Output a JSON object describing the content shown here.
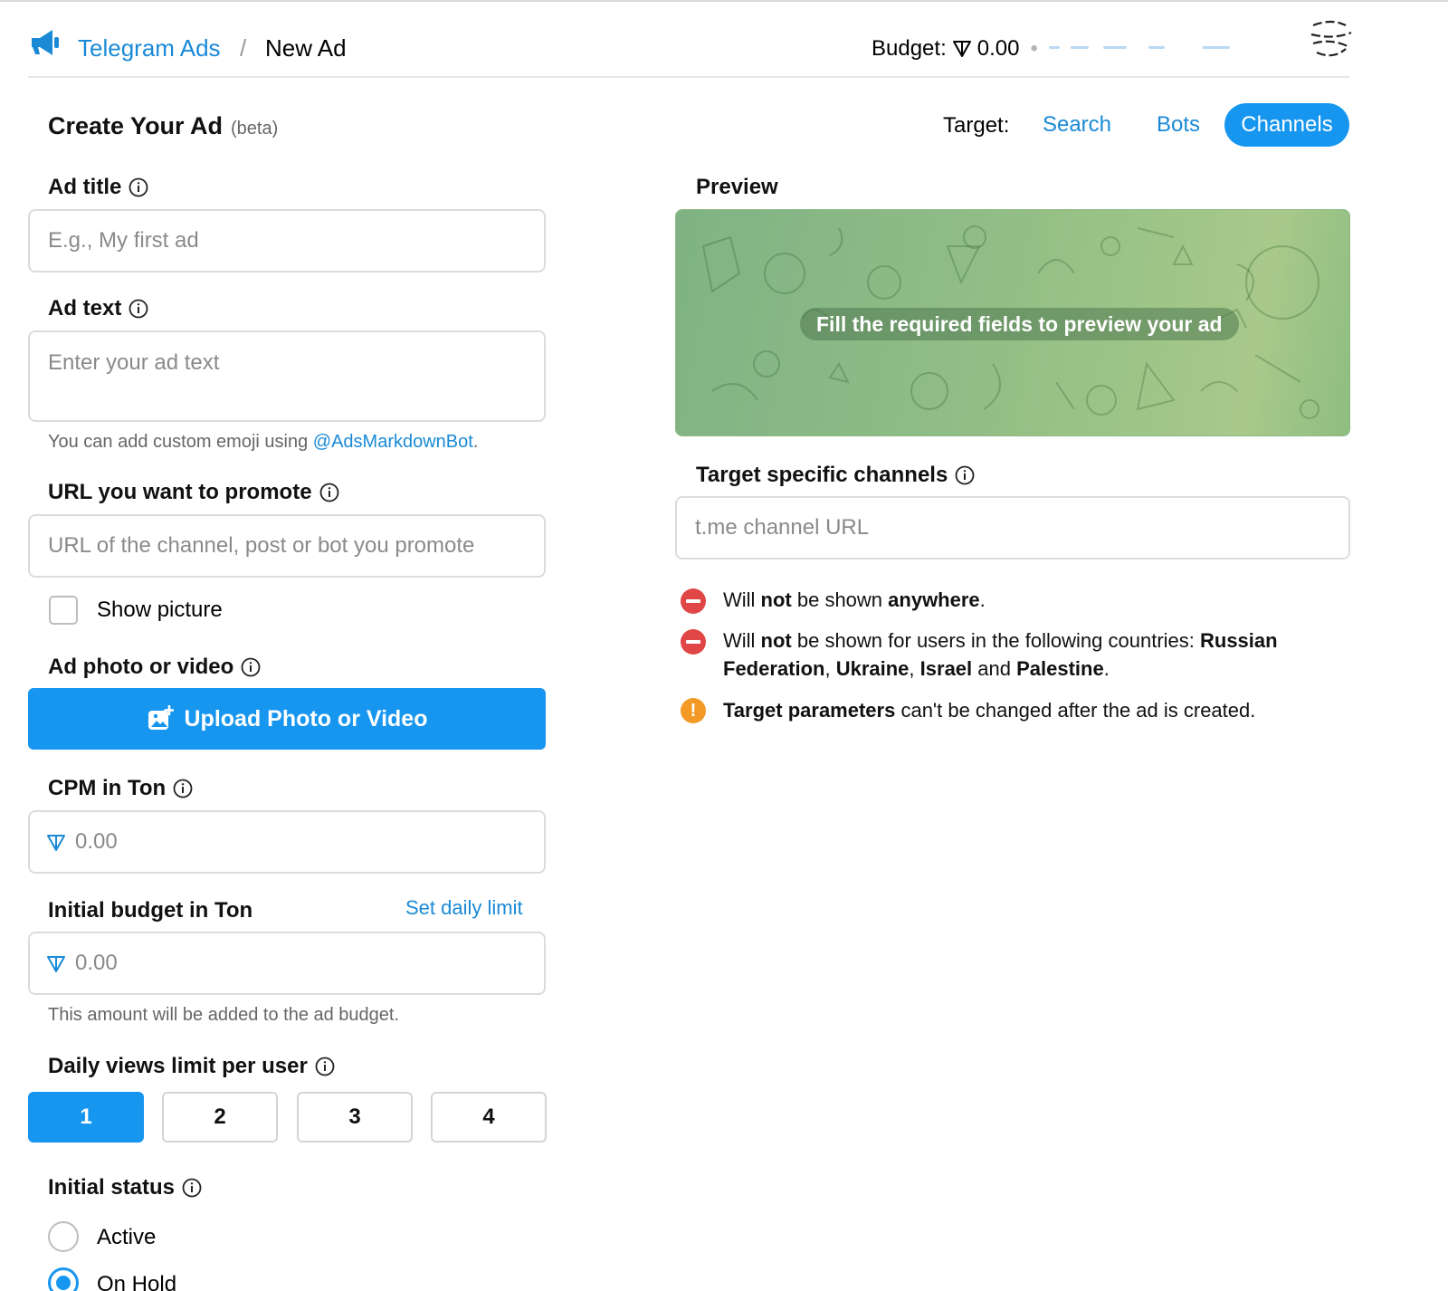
{
  "header": {
    "brand": "Telegram Ads",
    "separator": "/",
    "current": "New Ad",
    "budget_label": "Budget:",
    "budget_value": "0.00",
    "dot": "•"
  },
  "title": {
    "heading": "Create Your Ad",
    "beta": "(beta)",
    "target_label": "Target:",
    "targets": [
      "Search",
      "Bots",
      "Channels"
    ],
    "selected_target": "Channels"
  },
  "form": {
    "ad_title_label": "Ad title",
    "ad_title_placeholder": "E.g., My first ad",
    "ad_text_label": "Ad text",
    "ad_text_placeholder": "Enter your ad text",
    "emoji_hint_prefix": "You can add custom emoji using ",
    "emoji_hint_link": "@AdsMarkdownBot",
    "emoji_hint_suffix": ".",
    "url_label": "URL you want to promote",
    "url_placeholder": "URL of the channel, post or bot you promote",
    "show_picture": "Show picture",
    "photo_label": "Ad photo or video",
    "upload_button": "Upload Photo or Video",
    "cpm_label": "CPM in Ton",
    "cpm_placeholder": "0.00",
    "budget_label": "Initial budget in Ton",
    "set_daily_limit": "Set daily limit",
    "budget_placeholder": "0.00",
    "budget_hint": "This amount will be added to the ad budget.",
    "views_label": "Daily views limit per user",
    "views_options": [
      "1",
      "2",
      "3",
      "4"
    ],
    "views_selected": "1",
    "status_label": "Initial status",
    "status_options": [
      "Active",
      "On Hold"
    ],
    "status_selected": "On Hold"
  },
  "preview": {
    "label": "Preview",
    "message": "Fill the required fields to preview your ad"
  },
  "channels": {
    "label": "Target specific channels",
    "placeholder": "t.me channel URL"
  },
  "notes": {
    "n1_a": "Will ",
    "n1_b": "not",
    "n1_c": " be shown ",
    "n1_d": "anywhere",
    "n1_e": ".",
    "n2_a": "Will ",
    "n2_b": "not",
    "n2_c": " be shown for users in the following countries: ",
    "n2_d": "Russian Federation",
    "n2_e": ", ",
    "n2_f": "Ukraine",
    "n2_g": ", ",
    "n2_h": "Israel",
    "n2_i": " and ",
    "n2_j": "Palestine",
    "n2_k": ".",
    "n3_a": "Target parameters",
    "n3_b": " can't be changed after the ad is created.",
    "warn_glyph": "!"
  },
  "colors": {
    "accent": "#1796f0",
    "link": "#1a8ad7",
    "error": "#e04646",
    "warning": "#f39a26"
  }
}
